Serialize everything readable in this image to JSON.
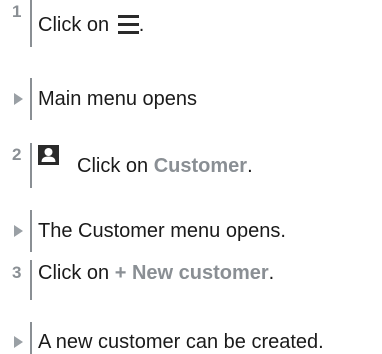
{
  "steps": [
    {
      "marker": "1",
      "prefix": "Click on ",
      "icon": "menu-icon",
      "suffix": "."
    },
    {
      "marker_icon": "triangle-bullet-icon",
      "text": "Main menu opens"
    },
    {
      "marker": "2",
      "icon": "customer-person-icon",
      "prefix": "Click on ",
      "link": "Customer",
      "suffix": "."
    },
    {
      "marker_icon": "triangle-bullet-icon",
      "text": "The Customer menu opens."
    },
    {
      "marker": "3",
      "prefix": "Click on ",
      "link": "+ New customer",
      "suffix": "."
    },
    {
      "marker_icon": "triangle-bullet-icon",
      "text": "A new customer can be created."
    }
  ],
  "colors": {
    "text": "#1a1a1a",
    "highlight": "#8a8f94",
    "marker": "#8a8f94"
  }
}
